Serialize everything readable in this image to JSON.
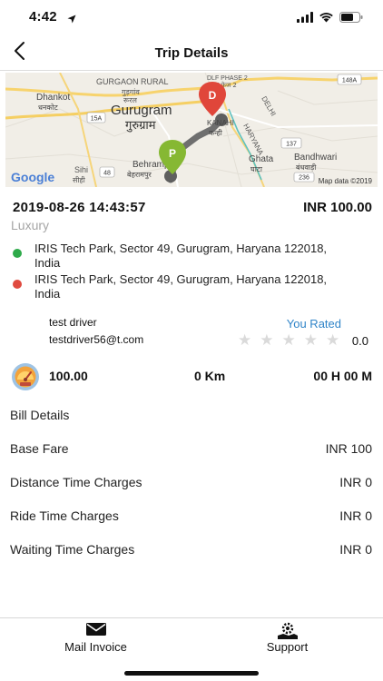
{
  "status_bar": {
    "time": "4:42"
  },
  "nav": {
    "title": "Trip Details"
  },
  "map": {
    "labels": {
      "gurgaon_rural": "GURGAON RURAL",
      "gurgaon_rural_hi": "गुड़गांव",
      "gurgaon_rural_hi2": "रूरल",
      "dhankot": "Dhankot",
      "dhankot_hi": "धनकोट",
      "gurugram": "Gurugram",
      "gurugram_hi": "गुरुग्राम",
      "dlf_phase2": "DLF PHASE 2",
      "dlf_phase2_hi": "DLF फेज 2",
      "kanahi": "KANAHI",
      "kanahi_hi": "कन्ही",
      "delhi": "DELHI",
      "haryana": "HARYANA",
      "ghata": "Ghata",
      "ghata_hi": "घाटा",
      "bandhwari": "Bandhwari",
      "bandhwari_hi": "बंधवाड़ी",
      "behrampur": "Behrampu",
      "behrampur_hi": "बेहरामपुर",
      "sihi": "Sihi",
      "sihi_hi": "सीही",
      "google": "Google",
      "attribution": "Map data ©2019",
      "shield_148a": "148A",
      "shield_15a": "15A",
      "shield_137": "137",
      "shield_48": "48",
      "shield_236": "236"
    },
    "pins": {
      "drop_letter": "D",
      "pickup_letter": "P"
    }
  },
  "trip": {
    "datetime": "2019-08-26 14:43:57",
    "amount": "INR 100.00",
    "vehicle_type": "Luxury",
    "pickup_address": "IRIS Tech Park, Sector 49, Gurugram, Haryana 122018, India",
    "drop_address": "IRIS Tech Park, Sector 49, Gurugram, Haryana 122018, India",
    "pickup_color": "#2eaa4a",
    "drop_color": "#e04a3f"
  },
  "driver": {
    "name": "test driver",
    "email": "testdriver56@t.com",
    "rated_label": "You Rated",
    "rating_value": "0.0",
    "rating_stars": 0,
    "star_glyph": "★"
  },
  "meter": {
    "fare": "100.00",
    "distance": "0 Km",
    "duration": "00 H 00 M"
  },
  "bill": {
    "title": "Bill Details",
    "rows": [
      {
        "label": "Base Fare",
        "value": "INR 100"
      },
      {
        "label": "Distance Time Charges",
        "value": "INR 0"
      },
      {
        "label": "Ride Time Charges",
        "value": "INR 0"
      },
      {
        "label": "Waiting Time Charges",
        "value": "INR 0"
      }
    ]
  },
  "bottom_bar": {
    "mail_label": "Mail Invoice",
    "support_label": "Support",
    "mail_icon": "envelope-icon",
    "support_icon": "support-gear-hand-icon"
  },
  "colors": {
    "accent": "#2f84c8",
    "route": "#6f6f6f",
    "drop_pin": "#e0463a",
    "pickup_pin": "#86b833"
  }
}
